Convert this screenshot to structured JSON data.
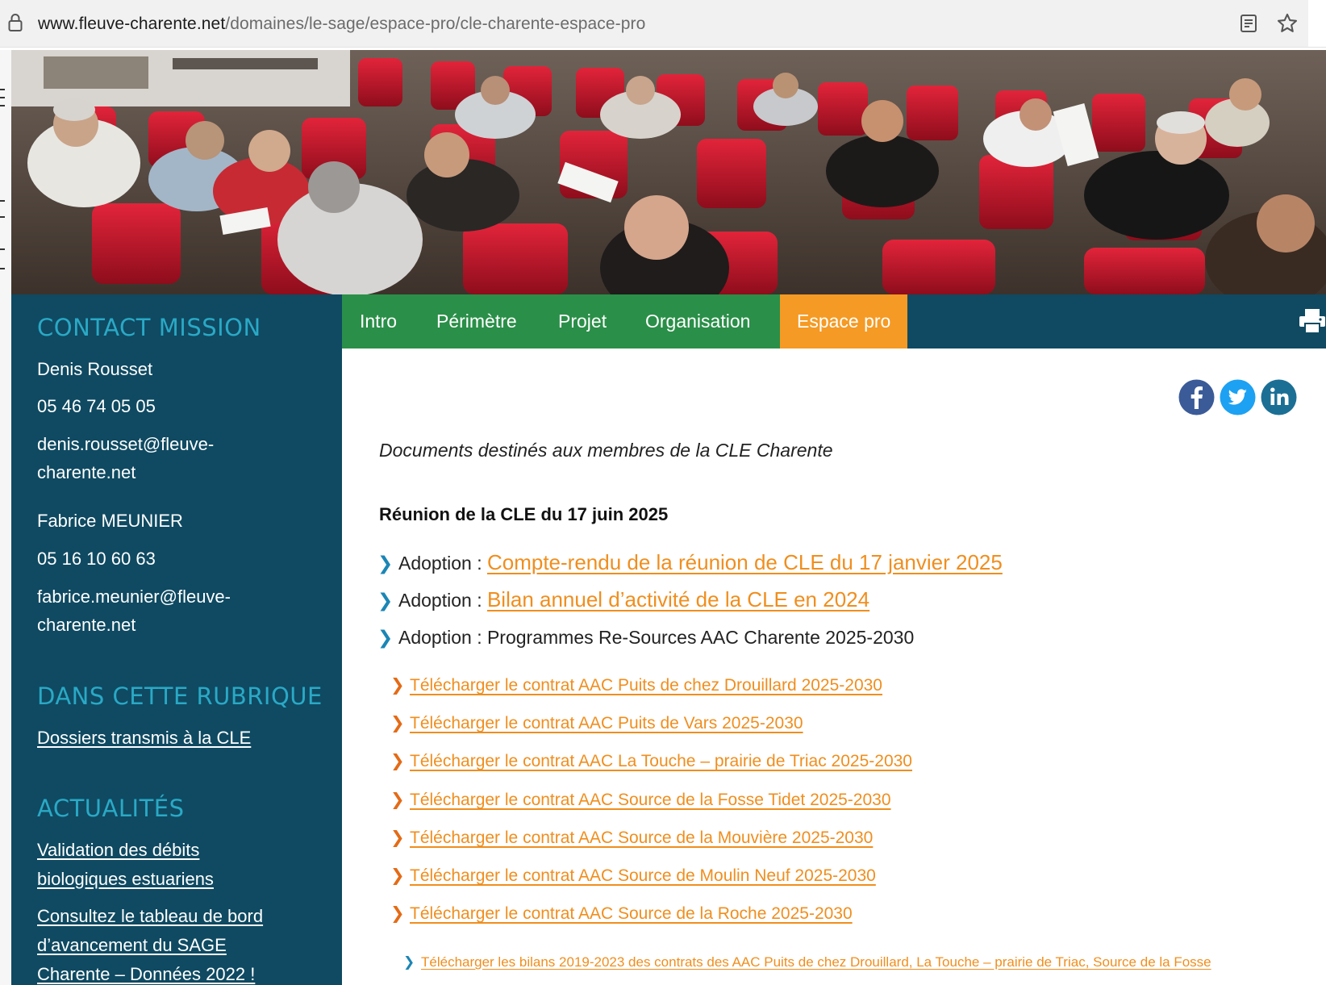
{
  "browser": {
    "url_host": "www.fleuve-charente.net",
    "url_path": "/domaines/le-sage/espace-pro/cle-charente-espace-pro"
  },
  "sidebar": {
    "contact_heading": "CONTACT MISSION",
    "contact1": {
      "name": "Denis Rousset",
      "phone": "05 46 74 05 05",
      "email_line1": "denis.rousset@fleuve-",
      "email_line2": "charente.net"
    },
    "contact2": {
      "name": "Fabrice MEUNIER",
      "phone": "05 16 10 60 63",
      "email_line1": "fabrice.meunier@fleuve-",
      "email_line2": "charente.net"
    },
    "rubrique_heading": "DANS CETTE RUBRIQUE",
    "rubrique_link": "Dossiers transmis à la CLE",
    "news_heading": "ACTUALITÉS",
    "news": [
      {
        "line1": "Validation des débits",
        "line2": "biologiques estuariens"
      },
      {
        "line1": "Consultez le tableau de bord",
        "line2": "d’avancement du SAGE",
        "line3": "Charente – Données 2022 !"
      }
    ]
  },
  "nav": {
    "tabs": [
      "Intro",
      "Périmètre",
      "Projet",
      "Organisation",
      "Espace pro"
    ],
    "active": "Espace pro"
  },
  "colors": {
    "dark_teal": "#0f4a62",
    "green": "#2a8f48",
    "orange": "#f59a24",
    "link": "#f08e1e",
    "heading_cyan": "#2aa9c6"
  },
  "content": {
    "intro": "Documents destinés aux membres de la CLE Charente",
    "meeting_title": "Réunion de la CLE du 17 juin 2025",
    "items": [
      {
        "prefix": "Adoption : ",
        "link": "Compte-rendu de la réunion de CLE du 17 janvier 2025"
      },
      {
        "prefix": "Adoption : ",
        "link": "Bilan annuel d’activité de la CLE en 2024"
      },
      {
        "prefix": "Adoption : ",
        "text": "Programmes Re-Sources AAC Charente 2025-2030"
      }
    ],
    "downloads": [
      "Télécharger le contrat AAC Puits de chez Drouillard 2025-2030",
      "Télécharger le contrat AAC Puits de Vars 2025-2030",
      "Télécharger le contrat AAC La Touche – prairie de Triac 2025-2030",
      "Télécharger le contrat AAC Source de la Fosse Tidet 2025-2030",
      "Télécharger le contrat AAC Source de la Mouvière 2025-2030",
      "Télécharger le contrat AAC Source de Moulin Neuf 2025-2030",
      "Télécharger le contrat AAC Source de la Roche 2025-2030"
    ],
    "bilans": "Télécharger les bilans 2019-2023 des contrats des AAC Puits de chez Drouillard, La Touche – prairie de Triac, Source de la Fosse"
  },
  "icons": {
    "lock": "lock-icon",
    "reader": "reader-view-icon",
    "star": "bookmark-star-icon",
    "printer": "printer-icon",
    "social": [
      "facebook-icon",
      "twitter-icon",
      "linkedin-icon"
    ]
  }
}
